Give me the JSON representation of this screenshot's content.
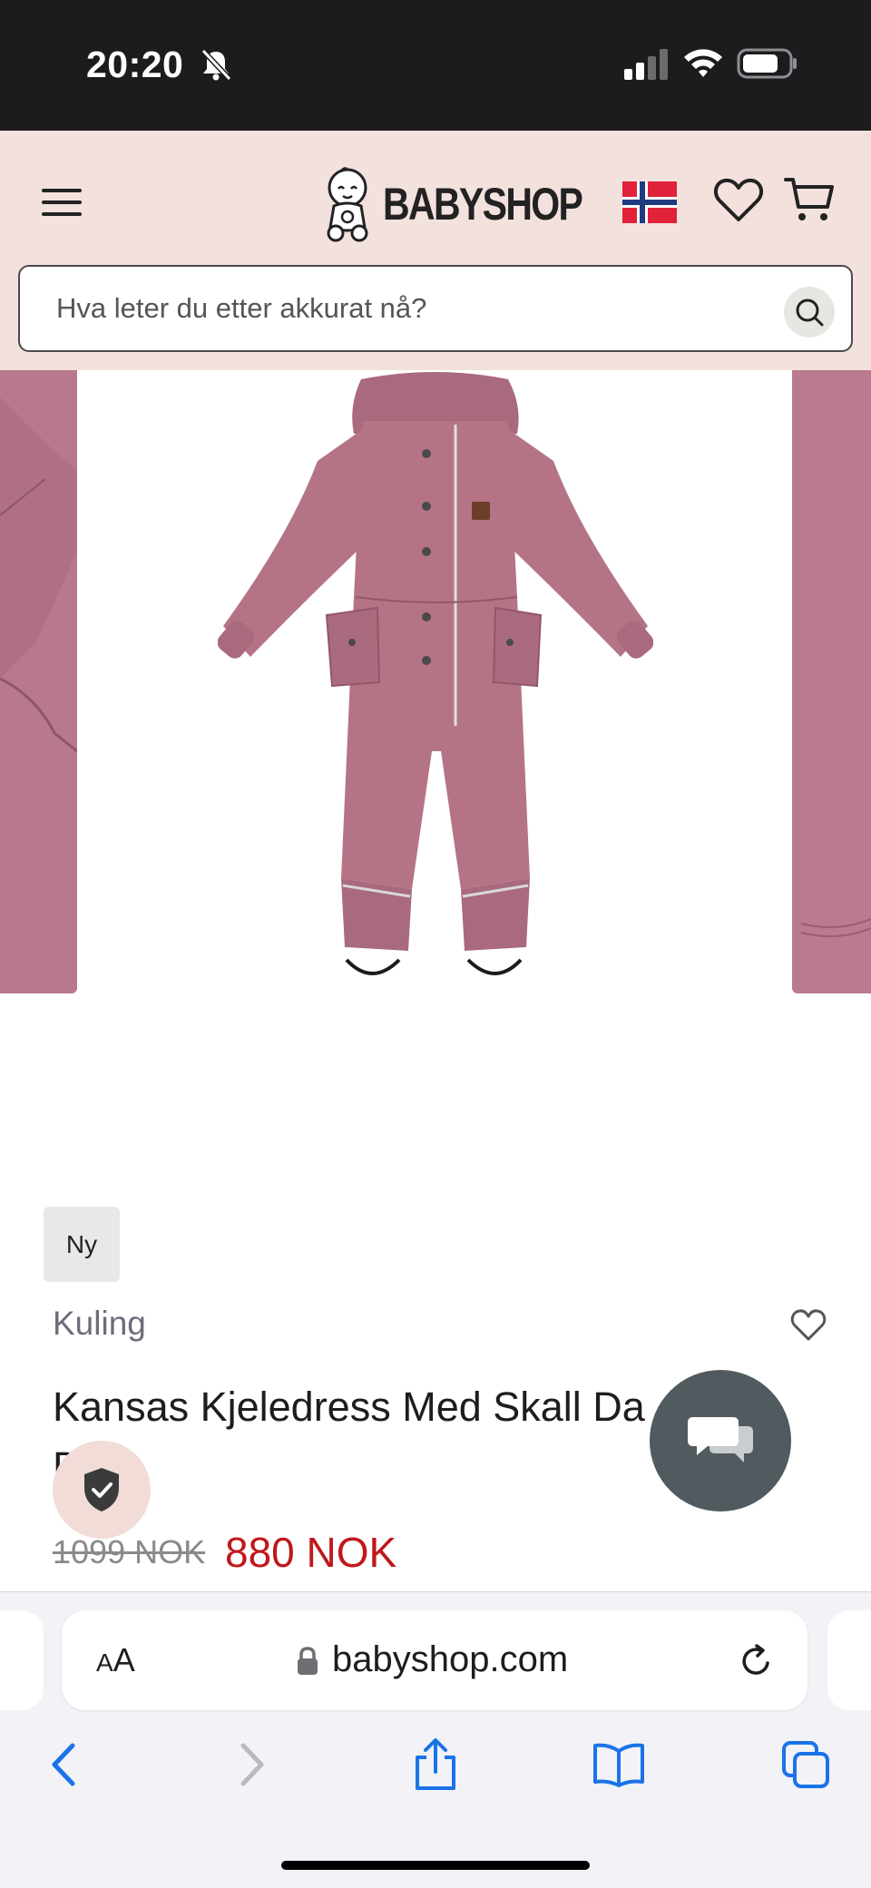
{
  "status_bar": {
    "time": "20:20"
  },
  "header": {
    "logo_text": "BABYSHOP",
    "search": {
      "placeholder": "Hva leter du etter akkurat nå?",
      "value": ""
    },
    "icons": [
      "menu-icon",
      "flag-norway-icon",
      "heart-icon",
      "cart-icon",
      "search-icon"
    ]
  },
  "product": {
    "badge": "Ny",
    "brand": "Kuling",
    "title": "Kansas Kjeledress Med Skall Da",
    "title_line2": "D",
    "price_old": "1099 NOK",
    "price_new": "880 NOK",
    "color_hex": "#b57486"
  },
  "browser": {
    "text_size_label_small": "A",
    "text_size_label_large": "A",
    "url": "babyshop.com",
    "accent": "#1a73e8"
  }
}
